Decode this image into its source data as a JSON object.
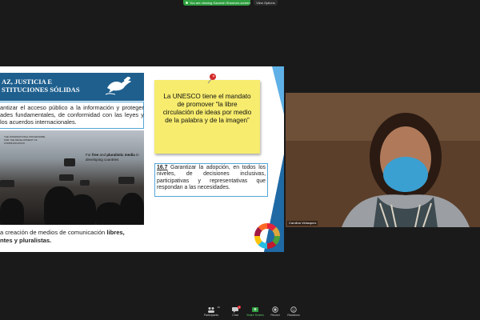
{
  "topbar": {
    "share_notice": "You are viewing Gauresh Sharma's screen",
    "view_options": "View Options"
  },
  "slide": {
    "banner_title_line1": "AZ, JUSTICIA E",
    "banner_title_line2": "STITUCIONES SÓLIDAS",
    "goal_text": "antizar el acceso público a la información y proteger ades fundamentales, de conformidad con las leyes y los acuerdos internacionales.",
    "photo_caption_line1": "THE INTERNATIONAL PROGRAMME",
    "photo_caption_line2": "FOR THE DEVELOPMENT OF COMMUNICATION",
    "photo_label_pre": "For ",
    "photo_label_bold": "free",
    "photo_label_mid": " and ",
    "photo_label_bold2": "pluralistic media",
    "photo_label_post": " in developing countries",
    "bottom_text_pre": "a creación de medios de comunicación ",
    "bottom_text_bold1": "libres,",
    "bottom_text_bold2": "ntes y pluralistas.",
    "sticky_text": "La UNESCO tiene el mandato de promover “la libre circulación de ideas por medio de la palabra y de la imagen”",
    "target_number": "16.7",
    "target_text": " Garantizar la adopción, en todos los niveles, de decisiones inclusivas, participativas y representativas que respondan a las necesidades."
  },
  "video": {
    "participant_name": "Carolina Velasquez"
  },
  "toolbar": {
    "items": [
      {
        "label": "Participants",
        "count": "20"
      },
      {
        "label": "Chat",
        "badge": "1"
      },
      {
        "label": "Share Screen"
      },
      {
        "label": "Record"
      },
      {
        "label": "Reactions"
      }
    ]
  },
  "colors": {
    "banner_blue": "#1e5f8e",
    "sticky_yellow": "#f7ec6e",
    "share_green": "#2f9e3f"
  }
}
